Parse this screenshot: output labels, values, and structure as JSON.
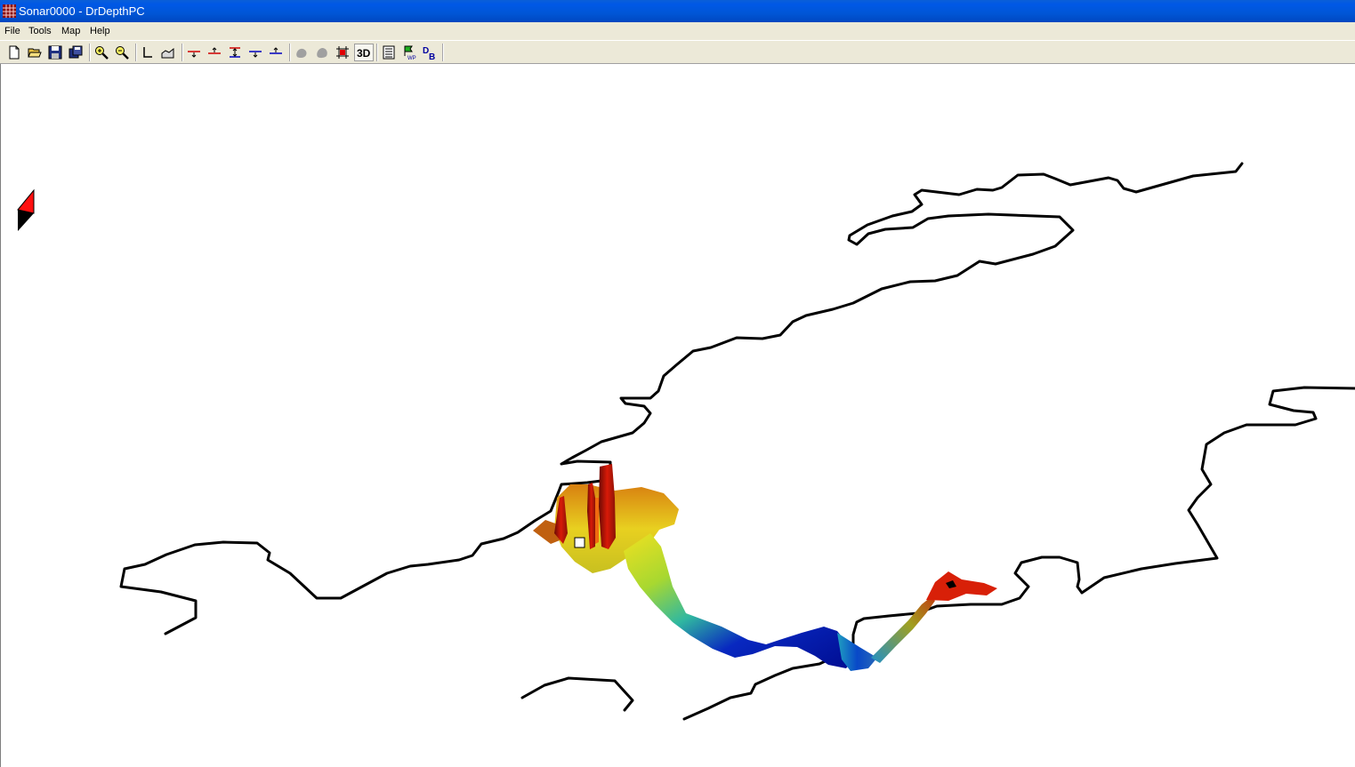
{
  "window": {
    "title": "Sonar0000 - DrDepthPC"
  },
  "menu": {
    "file": "File",
    "tools": "Tools",
    "map": "Map",
    "help": "Help"
  },
  "toolbar": {
    "view_3d_label": "3D",
    "waypoint_badge": "WP",
    "db_badge_d": "D",
    "db_badge_b": "B"
  },
  "colors": {
    "title_bar": "#0058e6",
    "menu_bg": "#ece9d8",
    "shoreline": "#000000",
    "depth_shallow": "#cc1010",
    "depth_mid": "#e8e020",
    "depth_deep": "#0018b0"
  },
  "icons": [
    "app-icon",
    "new-file-icon",
    "open-folder-icon",
    "save-icon",
    "save-all-icon",
    "zoom-in-icon",
    "zoom-out-icon",
    "axis-icon",
    "profile-icon",
    "depth-up-red-icon",
    "depth-down-red-icon",
    "depth-range-icon",
    "depth-up-blue-icon",
    "depth-down-blue-icon",
    "blob-icon",
    "blob-alt-icon",
    "grid-target-icon",
    "view-3d-icon",
    "list-icon",
    "waypoint-icon",
    "database-icon",
    "compass-icon"
  ]
}
